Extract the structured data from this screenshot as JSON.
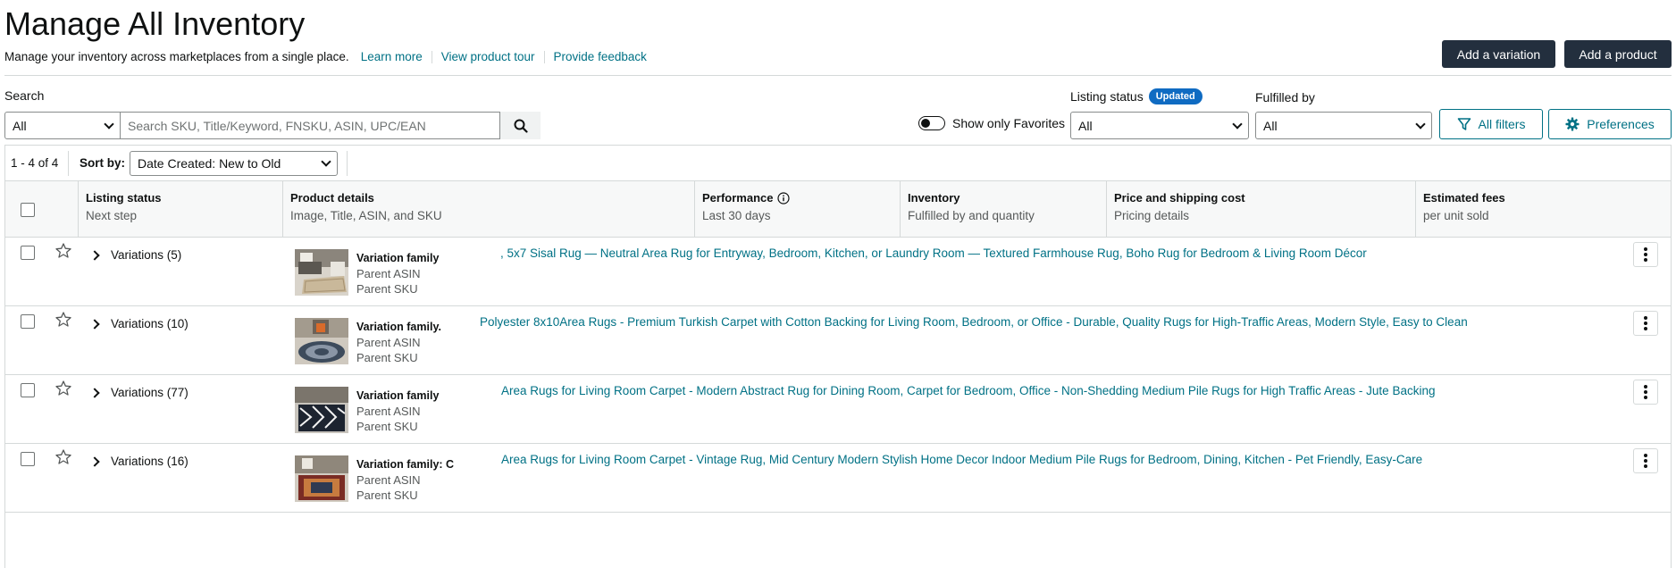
{
  "page": {
    "title": "Manage All Inventory",
    "subtitle": "Manage your inventory across marketplaces from a single place.",
    "links": [
      "Learn more",
      "View product tour",
      "Provide feedback"
    ],
    "add_variation_label": "Add a variation",
    "add_product_label": "Add a product"
  },
  "filters": {
    "search_label": "Search",
    "search_scope": "All",
    "search_placeholder": "Search SKU, Title/Keyword, FNSKU, ASIN, UPC/EAN",
    "favorites_label": "Show only Favorites",
    "listing_status_label": "Listing status",
    "listing_status_badge": "Updated",
    "listing_status_value": "All",
    "fulfilled_by_label": "Fulfilled by",
    "fulfilled_by_value": "All",
    "all_filters_label": "All filters",
    "preferences_label": "Preferences"
  },
  "table": {
    "count_text": "1 - 4 of 4",
    "sort_label": "Sort by:",
    "sort_value": "Date Created: New to Old",
    "columns": [
      {
        "title": "Listing status",
        "sub": "Next step"
      },
      {
        "title": "Product details",
        "sub": "Image, Title, ASIN, and SKU"
      },
      {
        "title": "Performance",
        "sub": "Last 30 days"
      },
      {
        "title": "Inventory",
        "sub": "Fulfilled by and quantity"
      },
      {
        "title": "Price and shipping cost",
        "sub": "Pricing details"
      },
      {
        "title": "Estimated fees",
        "sub": "per unit sold"
      }
    ],
    "rows": [
      {
        "variations": "Variations (5)",
        "family": "Variation family",
        "asin_label": "Parent ASIN",
        "sku_label": "Parent SKU",
        "title": ", 5x7 Sisal Rug — Neutral Area Rug for Entryway, Bedroom, Kitchen, or Laundry Room — Textured Farmhouse Rug, Boho Rug for Bedroom & Living Room Décor"
      },
      {
        "variations": "Variations (10)",
        "family": "Variation family.",
        "asin_label": "Parent ASIN",
        "sku_label": "Parent SKU",
        "title": "Polyester 8x10Area Rugs - Premium Turkish Carpet with Cotton Backing for Living Room, Bedroom, or Office - Durable, Quality Rugs for High-Traffic Areas, Modern Style, Easy to Clean"
      },
      {
        "variations": "Variations (77)",
        "family": "Variation family",
        "asin_label": "Parent ASIN",
        "sku_label": "Parent SKU",
        "title": "Area Rugs for Living Room Carpet - Modern Abstract Rug for Dining Room, Carpet for Bedroom, Office - Non-Shedding Medium Pile Rugs for High Traffic Areas - Jute Backing"
      },
      {
        "variations": "Variations (16)",
        "family": "Variation family: C",
        "asin_label": "Parent ASIN",
        "sku_label": "Parent SKU",
        "title": "Area Rugs for Living Room Carpet - Vintage Rug, Mid Century Modern Stylish Home Decor Indoor Medium Pile Rugs for Bedroom, Dining, Kitchen - Pet Friendly, Easy-Care"
      }
    ]
  },
  "colors": {
    "link": "#007185",
    "dark_button": "#232f3e",
    "badge": "#0f6bc2"
  }
}
